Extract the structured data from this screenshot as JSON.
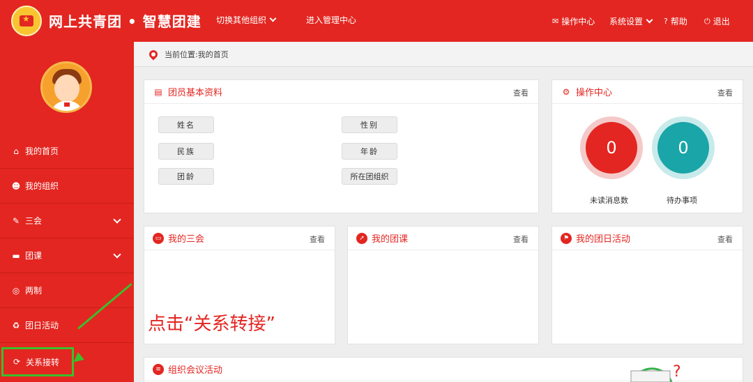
{
  "header": {
    "app_title": "网上共青团 • 智慧团建",
    "switch_org": "切换其他组织",
    "admin_center": "进入管理中心",
    "ops_center": "操作中心",
    "system_settings": "系统设置",
    "help": "帮助",
    "logout": "退出"
  },
  "sidebar": {
    "items": [
      {
        "label": "我的首页",
        "icon": "home-icon"
      },
      {
        "label": "我的组织",
        "icon": "users-icon"
      },
      {
        "label": "三会",
        "icon": "edit-icon"
      },
      {
        "label": "团课",
        "icon": "folder-icon"
      },
      {
        "label": "两制",
        "icon": "target-icon"
      },
      {
        "label": "团日活动",
        "icon": "recycle-icon"
      },
      {
        "label": "关系接转",
        "icon": "refresh-icon"
      }
    ]
  },
  "breadcrumb": "当前位置:我的首页",
  "profile_panel": {
    "title": "团员基本资料",
    "more": "查看",
    "fields": [
      "姓名",
      "性别",
      "民族",
      "年龄",
      "团龄",
      "所在团组织"
    ]
  },
  "ops_panel": {
    "title": "操作中心",
    "more": "查看",
    "unread_count": "0",
    "unread_label": "未读消息数",
    "todo_count": "0",
    "todo_label": "待办事项"
  },
  "meetings_panel": {
    "title": "我的三会",
    "more": "查看"
  },
  "courses_panel": {
    "title": "我的团课",
    "more": "查看"
  },
  "activities_panel": {
    "title": "我的团日活动",
    "more": "查看"
  },
  "org_meetings_panel": {
    "title": "组织会议活动"
  },
  "annotation": "点击“关系转接”",
  "colors": {
    "primary": "#e32621",
    "highlight": "#3bbf2c",
    "teal": "#1aa5a8"
  }
}
